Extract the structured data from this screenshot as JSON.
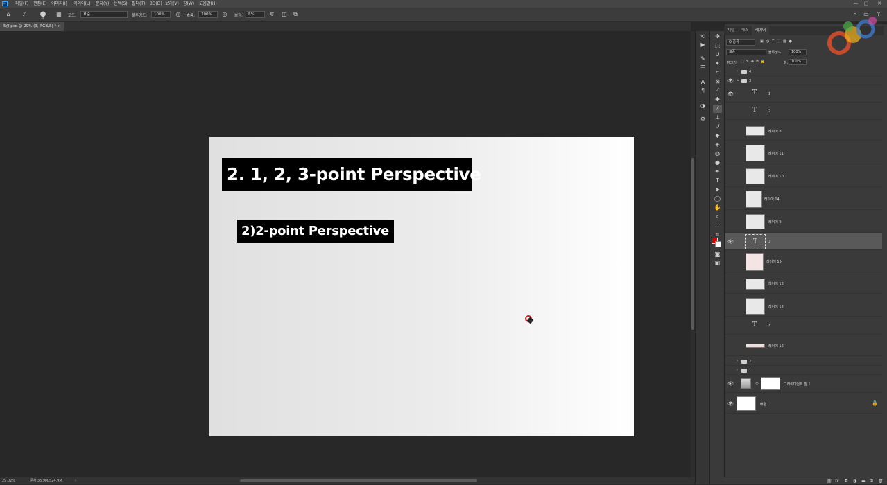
{
  "menubar": {
    "logo": "Ps",
    "items": [
      "파일(F)",
      "편집(E)",
      "이미지(I)",
      "레이어(L)",
      "문자(Y)",
      "선택(S)",
      "필터(T)",
      "3D(D)",
      "보기(V)",
      "창(W)",
      "도움말(H)"
    ],
    "window_controls": [
      "—",
      "▢",
      "✕"
    ]
  },
  "options": {
    "brush_size": "36",
    "mode_label": "모드:",
    "mode_value": "표준",
    "opacity_label": "불투명도:",
    "opacity_value": "100%",
    "flow_label": "흐름:",
    "flow_value": "100%",
    "smoothing_label": "보정:",
    "smoothing_value": "8%"
  },
  "document": {
    "tab_title": "5강.psd @ 29% (3, RGB/8) *"
  },
  "canvas": {
    "title": "2. 1, 2, 3-point Perspective",
    "subtitle": "2)2-point Perspective"
  },
  "status": {
    "zoom": "29.02%",
    "doc_size": "문서:35.9M/524.9M"
  },
  "panel": {
    "tabs": [
      "채널",
      "패스",
      "레이어"
    ],
    "active_tab": "레이어",
    "filter_label": "Q 종류",
    "blend_mode": "표준",
    "opacity_label": "불투명도:",
    "opacity_value": "100%",
    "lock_label": "잠그기:",
    "fill_label": "칠:",
    "fill_value": "100%"
  },
  "layers": [
    {
      "name": "4",
      "type": "group",
      "visible": false,
      "expanded": false,
      "indent": 0
    },
    {
      "name": "3",
      "type": "group",
      "visible": true,
      "expanded": true,
      "indent": 0
    },
    {
      "name": "1",
      "type": "text",
      "visible": true,
      "indent": 1
    },
    {
      "name": "2",
      "type": "text",
      "visible": false,
      "indent": 1
    },
    {
      "name": "레이어 8",
      "type": "pixel",
      "visible": false,
      "indent": 1
    },
    {
      "name": "레이어 11",
      "type": "pixel",
      "visible": false,
      "indent": 1
    },
    {
      "name": "레이어 10",
      "type": "pixel",
      "visible": false,
      "indent": 1
    },
    {
      "name": "레이어 14",
      "type": "pixel",
      "visible": false,
      "indent": 1
    },
    {
      "name": "레이어 9",
      "type": "pixel",
      "visible": false,
      "indent": 1
    },
    {
      "name": "3",
      "type": "text",
      "visible": true,
      "selected": true,
      "indent": 1
    },
    {
      "name": "레이어 15",
      "type": "pixel",
      "visible": false,
      "indent": 1
    },
    {
      "name": "레이어 13",
      "type": "pixel",
      "visible": false,
      "indent": 1
    },
    {
      "name": "레이어 12",
      "type": "pixel",
      "visible": false,
      "indent": 1
    },
    {
      "name": "4",
      "type": "text",
      "visible": false,
      "indent": 1
    },
    {
      "name": "레이어 16",
      "type": "pixel",
      "visible": false,
      "indent": 1
    },
    {
      "name": "2",
      "type": "group",
      "visible": false,
      "expanded": false,
      "indent": 0
    },
    {
      "name": "1",
      "type": "group",
      "visible": false,
      "expanded": false,
      "indent": 0
    },
    {
      "name": "그레이디언트 칠 1",
      "type": "fill",
      "visible": true,
      "indent": 0
    },
    {
      "name": "배경",
      "type": "background",
      "visible": true,
      "locked": true,
      "indent": 0
    }
  ],
  "footer_icons": [
    "link-icon",
    "fx-icon",
    "mask-icon",
    "adjustment-icon",
    "folder-icon",
    "new-layer-icon",
    "trash-icon"
  ],
  "colors": {
    "foreground": "#e00000",
    "background": "#ffffff",
    "accent": "#31a8ff"
  }
}
